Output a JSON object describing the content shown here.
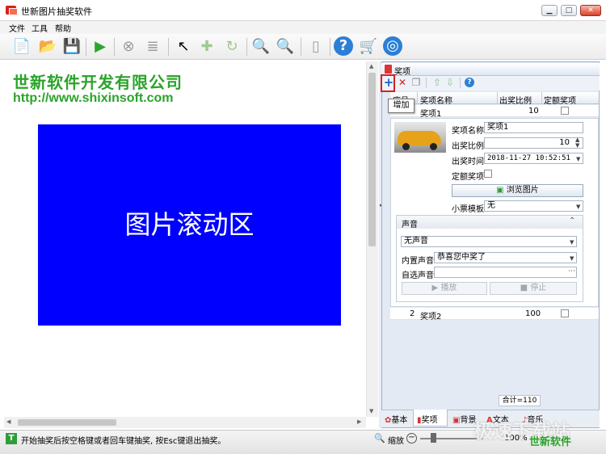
{
  "window": {
    "title": "世新图片抽奖软件",
    "minimize": "▁",
    "maximize": "□",
    "close": "✕"
  },
  "menu": [
    "文件",
    "工具",
    "帮助"
  ],
  "company": {
    "name": "世新软件开发有限公司",
    "url": "http://www.shixinsoft.com"
  },
  "scroll_area": {
    "label": "图片滚动区",
    "color": "#0000ff"
  },
  "panel": {
    "title": "奖项",
    "tooltip": "增加"
  },
  "grid": {
    "headers": [
      "序号",
      "奖项名称",
      "出奖比例",
      "定额奖项"
    ],
    "rows": [
      {
        "index": "1",
        "name": "奖项1",
        "ratio": "10"
      },
      {
        "index": "2",
        "name": "奖项2",
        "ratio": "100"
      }
    ]
  },
  "detail": {
    "name_label": "奖项名称",
    "name_value": "奖项1",
    "ratio_label": "出奖比例",
    "ratio_value": "10",
    "time_label": "出奖时间",
    "time_value": "2018-11-27 10:52:51",
    "fixed_label": "定额奖项",
    "browse_label": "浏览图片",
    "ticket_label": "小票模板",
    "ticket_value": "无"
  },
  "sound": {
    "title": "声音",
    "mode": "无声音",
    "builtin_label": "内置声音",
    "builtin_value": "恭喜您中奖了",
    "custom_label": "自选声音",
    "play": "播放",
    "stop": "停止"
  },
  "total": "合计=110",
  "tabs": [
    "基本",
    "奖项",
    "背景",
    "文本",
    "音乐"
  ],
  "status": {
    "text": "开始抽奖后按空格键或者回车键抽奖, 按Esc键退出抽奖。",
    "zoom_label": "缩放",
    "zoom_value": "100%"
  },
  "watermark": {
    "top": "极速下载站",
    "bottom": "世新软件"
  }
}
